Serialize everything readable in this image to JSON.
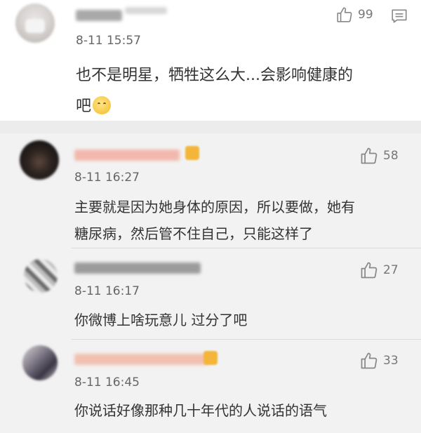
{
  "main_comment": {
    "time": "8-11 15:57",
    "text_line1": "也不是明星，牺牲这么大...会影响健康的",
    "text_line2": "吧",
    "emoji": "shush-face-emoji",
    "likes": "99",
    "icon_like": "thumbs-up-icon",
    "icon_comment": "comment-icon"
  },
  "replies": [
    {
      "time": "8-11 16:27",
      "text_line1": "主要就是因为她身体的原因，所以要做，她有",
      "text_line2": "糖尿病，然后管不住自己，只能这样了",
      "likes": "58"
    },
    {
      "time": "8-11 16:17",
      "text_line1": "你微博上啥玩意儿 过分了吧",
      "likes": "27"
    },
    {
      "time": "8-11 16:45",
      "text_line1": "你说话好像那种几十年代的人说话的语气",
      "likes": "33"
    }
  ],
  "colors": {
    "background": "#ffffff",
    "reply_background": "#f2f2f2",
    "divider": "#ececec",
    "text": "#333333",
    "meta": "#666666",
    "vip_badge": "#f3b63a"
  }
}
